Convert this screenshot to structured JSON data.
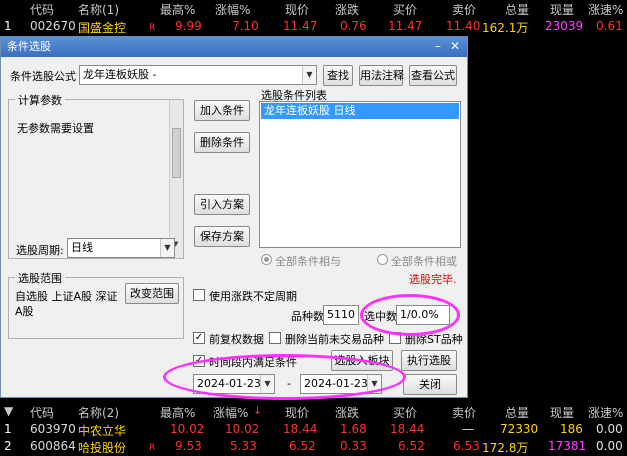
{
  "top_quote": {
    "headers": [
      "代码",
      "名称(1)",
      "最高%",
      "涨幅%",
      "现价",
      "涨跌",
      "买价",
      "卖价",
      "总量",
      "现量",
      "涨速%"
    ],
    "row": {
      "idx": "1",
      "code": "002670",
      "name": "国盛金控",
      "flag": "R",
      "high_pct": "9.99",
      "change_pct": "7.10",
      "price": "11.47",
      "change": "0.76",
      "bid": "11.47",
      "ask": "11.40",
      "volume": "162.1万",
      "cur_vol": "23039",
      "speed": "0.61"
    }
  },
  "dialog": {
    "title": "条件选股",
    "formula_label": "条件选股公式",
    "formula_value": "龙年连板妖股  -",
    "btn_find": "查找",
    "btn_usage": "用法注释",
    "btn_view": "查看公式",
    "params_title": "计算参数",
    "params_text": "无参数需要设置",
    "btn_add": "加入条件",
    "btn_delete": "删除条件",
    "btn_import": "引入方案",
    "btn_save": "保存方案",
    "list_title": "选股条件列表",
    "list_items": [
      "龙年连板妖股  日线"
    ],
    "period_label": "选股周期:",
    "period_value": "日线",
    "radio_and": "全部条件相与",
    "radio_or": "全部条件相或",
    "status": "选股完毕.",
    "range_title": "选股范围",
    "range_text_1": "自选股 上证A股 深证",
    "range_text_2": "A股",
    "btn_change_range": "改变范围",
    "chk_irregular": "使用涨跌不定周期",
    "count_label": "品种数",
    "count_value": "5110",
    "selected_label": "选中数",
    "selected_value": "1/0.0%",
    "chk_prior": "前复权数据",
    "chk_remove_no_trade": "删除当前未交易品种",
    "chk_remove_st": "删除ST品种",
    "chk_time_range": "时间段内满足条件",
    "btn_into_block": "选股入板块",
    "btn_execute": "执行选股",
    "date_from": "2024-01-23",
    "date_sep": "-",
    "date_to": "2024-01-23",
    "btn_close": "关闭"
  },
  "bottom_quote": {
    "headers": [
      "代码",
      "名称(2)",
      "最高%",
      "涨幅%",
      "现价",
      "涨跌",
      "买价",
      "卖价",
      "总量",
      "现量",
      "涨速%"
    ],
    "rows": [
      {
        "idx": "1",
        "code": "603970",
        "name": "中农立华",
        "flag": "",
        "high_pct": "10.02",
        "change_pct": "10.02",
        "price": "18.44",
        "change": "1.68",
        "bid": "18.44",
        "ask": "—",
        "volume": "72330",
        "cur_vol": "186",
        "speed": "0.00"
      },
      {
        "idx": "2",
        "code": "600864",
        "name": "哈投股份",
        "flag": "R",
        "high_pct": "9.53",
        "change_pct": "5.33",
        "price": "6.52",
        "change": "0.33",
        "bid": "6.52",
        "ask": "6.53",
        "volume": "172.8万",
        "cur_vol": "17381",
        "speed": "0.00"
      }
    ]
  }
}
